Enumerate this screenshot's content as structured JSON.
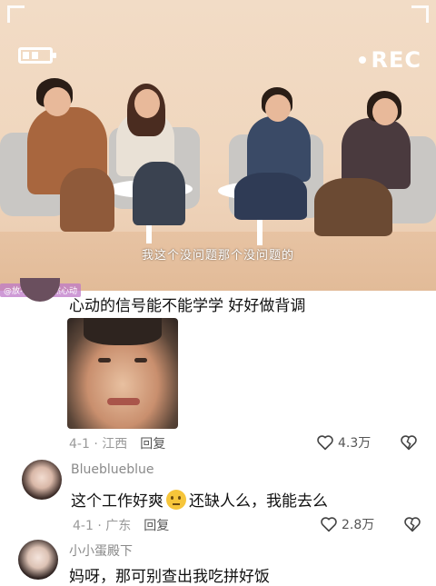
{
  "video": {
    "rec_label": "REC",
    "subtitle": "我这个没问题那个没问题的",
    "watermark": "@放不掉的竟然心动"
  },
  "comments": [
    {
      "username": "",
      "text": "心动的信号能不能学学 好好做背调",
      "has_image": true,
      "date": "4-1",
      "location": "江西",
      "reply_label": "回复",
      "likes": "4.3万"
    },
    {
      "username": "Blueblueblue",
      "text_before": "这个工作好爽",
      "text_after": "还缺人么，我能去么",
      "date": "4-1",
      "location": "广东",
      "reply_label": "回复",
      "likes": "2.8万"
    },
    {
      "username": "小小蛋殿下",
      "text": "妈呀，那可别查出我吃拼好饭"
    }
  ],
  "icons": {
    "like": "heart-outline-icon",
    "dislike": "broken-heart-icon",
    "emoji": "thinking-face-icon"
  },
  "colors": {
    "meta": "#999999",
    "username": "#8a8a8a",
    "watermark_bg": "#be78c8"
  }
}
